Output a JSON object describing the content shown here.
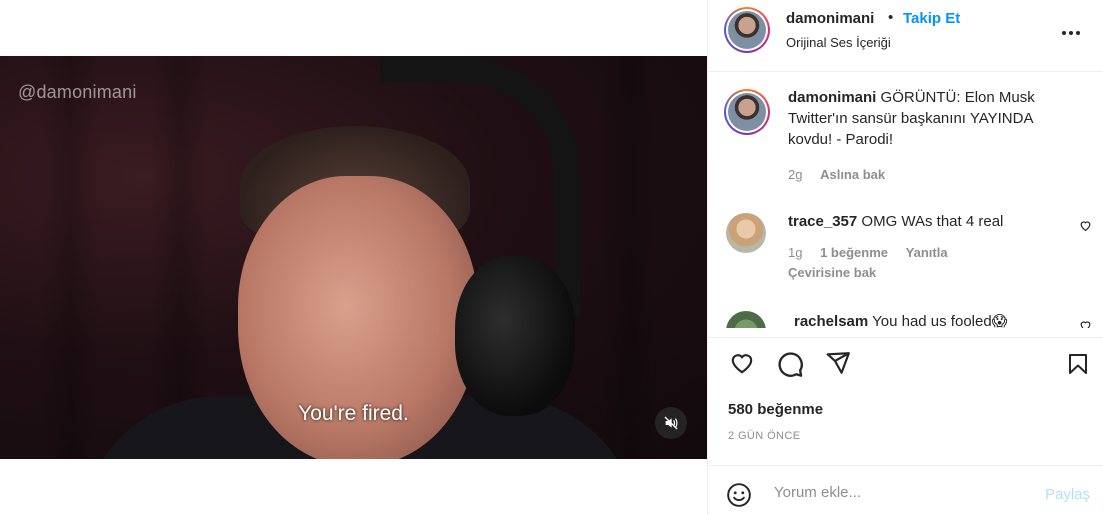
{
  "video": {
    "watermark": "@damonimani",
    "caption": "You're fired.",
    "mute_icon": "speaker-muted-icon"
  },
  "header": {
    "username": "damonimani",
    "separator": "•",
    "follow_label": "Takip Et",
    "audio_label": "Orijinal Ses İçeriği",
    "more_icon": "more-horizontal-icon"
  },
  "caption_post": {
    "username": "damonimani",
    "text": "GÖRÜNTÜ: Elon Musk Twitter'ın sansür başkanını YAYINDA kovdu! - Parodi!",
    "time": "2g",
    "see_translation": "Aslına bak"
  },
  "comments": [
    {
      "username": "trace_357",
      "text": "OMG WAs that 4 real",
      "time": "1g",
      "likes": "1 beğenme",
      "reply": "Yanıtla",
      "translation": "Çevirisine bak"
    },
    {
      "username": "rachelsam",
      "text": "You had us fooled😱"
    }
  ],
  "actions": {
    "likes_count": "580 beğenme",
    "date": "2 GÜN ÖNCE"
  },
  "add_comment": {
    "placeholder": "Yorum ekle...",
    "share_label": "Paylaş"
  },
  "colors": {
    "accent": "#0095f6",
    "share_disabled": "#b2dffc",
    "muted_text": "#8e8e8e"
  }
}
